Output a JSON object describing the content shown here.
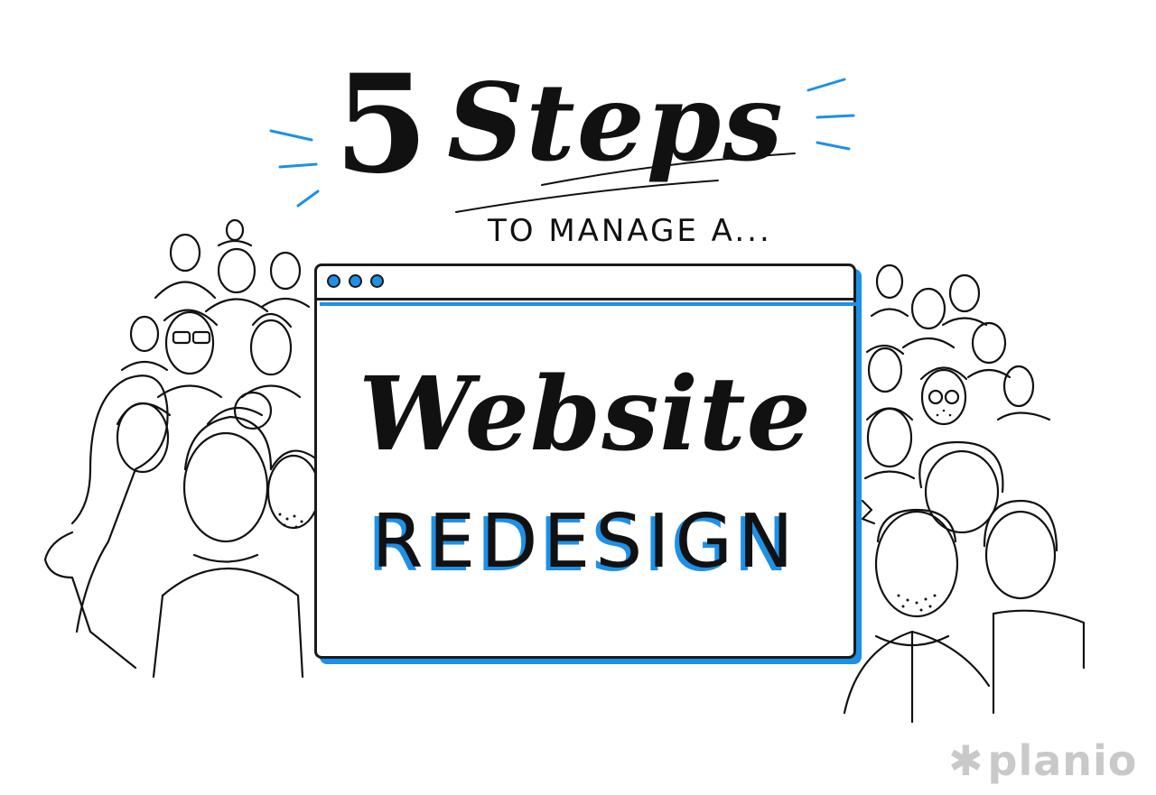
{
  "title": {
    "number": "5",
    "word": "Steps"
  },
  "subtitle": "TO MANAGE A...",
  "window": {
    "headline": "Website",
    "subheadline": "REDESIGN"
  },
  "logo": {
    "text": "planio",
    "icon": "asterisk-icon"
  },
  "colors": {
    "accent": "#1e90e6",
    "ink": "#111111",
    "logo": "#c9c9c9"
  }
}
